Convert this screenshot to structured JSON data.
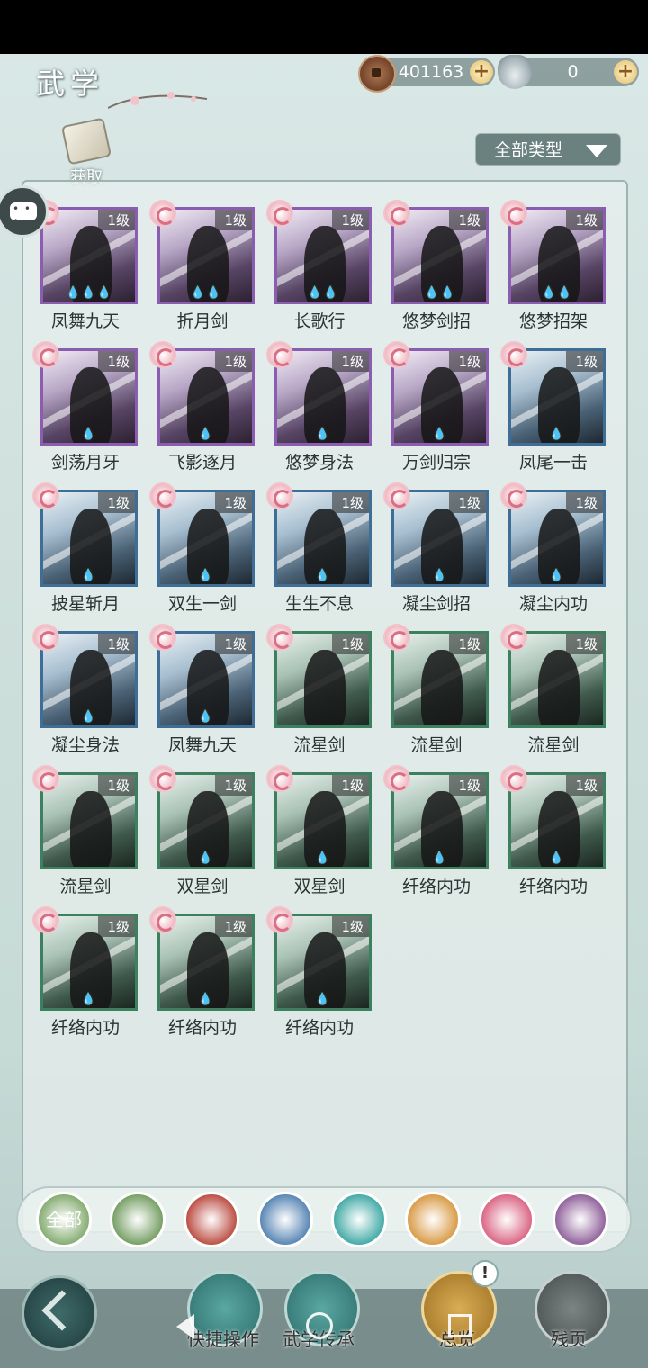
{
  "header": {
    "title": "武学",
    "copper": {
      "value": "401163",
      "plus": "+"
    },
    "silver": {
      "value": "0",
      "plus": "+"
    },
    "get_label": "获取",
    "filter_label": "全部类型"
  },
  "skills": [
    {
      "name": "凤舞九天",
      "level": "1级",
      "quality": "purple",
      "flames": "💧💧💧"
    },
    {
      "name": "折月剑",
      "level": "1级",
      "quality": "purple",
      "flames": "💧💧"
    },
    {
      "name": "长歌行",
      "level": "1级",
      "quality": "purple",
      "flames": "💧💧"
    },
    {
      "name": "悠梦剑招",
      "level": "1级",
      "quality": "purple",
      "flames": "💧💧"
    },
    {
      "name": "悠梦招架",
      "level": "1级",
      "quality": "purple",
      "flames": "💧💧"
    },
    {
      "name": "剑荡月牙",
      "level": "1级",
      "quality": "purple",
      "flames": "💧"
    },
    {
      "name": "飞影逐月",
      "level": "1级",
      "quality": "purple",
      "flames": "💧"
    },
    {
      "name": "悠梦身法",
      "level": "1级",
      "quality": "purple",
      "flames": "💧"
    },
    {
      "name": "万剑归宗",
      "level": "1级",
      "quality": "purple",
      "flames": "💧"
    },
    {
      "name": "凤尾一击",
      "level": "1级",
      "quality": "blue",
      "flames": "💧"
    },
    {
      "name": "披星斩月",
      "level": "1级",
      "quality": "blue",
      "flames": "💧"
    },
    {
      "name": "双生一剑",
      "level": "1级",
      "quality": "blue",
      "flames": "💧"
    },
    {
      "name": "生生不息",
      "level": "1级",
      "quality": "blue",
      "flames": "💧"
    },
    {
      "name": "凝尘剑招",
      "level": "1级",
      "quality": "blue",
      "flames": "💧"
    },
    {
      "name": "凝尘内功",
      "level": "1级",
      "quality": "blue",
      "flames": "💧"
    },
    {
      "name": "凝尘身法",
      "level": "1级",
      "quality": "blue",
      "flames": "💧"
    },
    {
      "name": "凤舞九天",
      "level": "1级",
      "quality": "blue",
      "flames": "💧"
    },
    {
      "name": "流星剑",
      "level": "1级",
      "quality": "green",
      "flames": ""
    },
    {
      "name": "流星剑",
      "level": "1级",
      "quality": "green",
      "flames": ""
    },
    {
      "name": "流星剑",
      "level": "1级",
      "quality": "green",
      "flames": ""
    },
    {
      "name": "流星剑",
      "level": "1级",
      "quality": "green",
      "flames": ""
    },
    {
      "name": "双星剑",
      "level": "1级",
      "quality": "green",
      "flames": "💧"
    },
    {
      "name": "双星剑",
      "level": "1级",
      "quality": "green",
      "flames": "💧"
    },
    {
      "name": "纤络内功",
      "level": "1级",
      "quality": "green",
      "flames": "💧"
    },
    {
      "name": "纤络内功",
      "level": "1级",
      "quality": "green",
      "flames": "💧"
    },
    {
      "name": "纤络内功",
      "level": "1级",
      "quality": "green",
      "flames": "💧"
    },
    {
      "name": "纤络内功",
      "level": "1级",
      "quality": "green",
      "flames": "💧"
    },
    {
      "name": "纤络内功",
      "level": "1级",
      "quality": "green",
      "flames": "💧"
    }
  ],
  "school_tabs": [
    {
      "label": "全部",
      "icon": "all-icon",
      "color": "#7fa86a"
    },
    {
      "label": "",
      "icon": "feather-icon",
      "color": "#6f9a5c"
    },
    {
      "label": "",
      "icon": "flame-icon",
      "color": "#b8453a"
    },
    {
      "label": "",
      "icon": "wave-icon",
      "color": "#4f7fb0"
    },
    {
      "label": "",
      "icon": "butterfly-icon",
      "color": "#3aa6a2"
    },
    {
      "label": "",
      "icon": "shield-icon",
      "color": "#d7963f"
    },
    {
      "label": "",
      "icon": "moon-icon",
      "color": "#d85e7e"
    },
    {
      "label": "",
      "icon": "cloud-icon",
      "color": "#8a5a96"
    }
  ],
  "bottom": {
    "quick_ops": "快捷操作",
    "inherit": "武学传承",
    "overview": "总览",
    "fragments": "残页",
    "alert": "!"
  }
}
